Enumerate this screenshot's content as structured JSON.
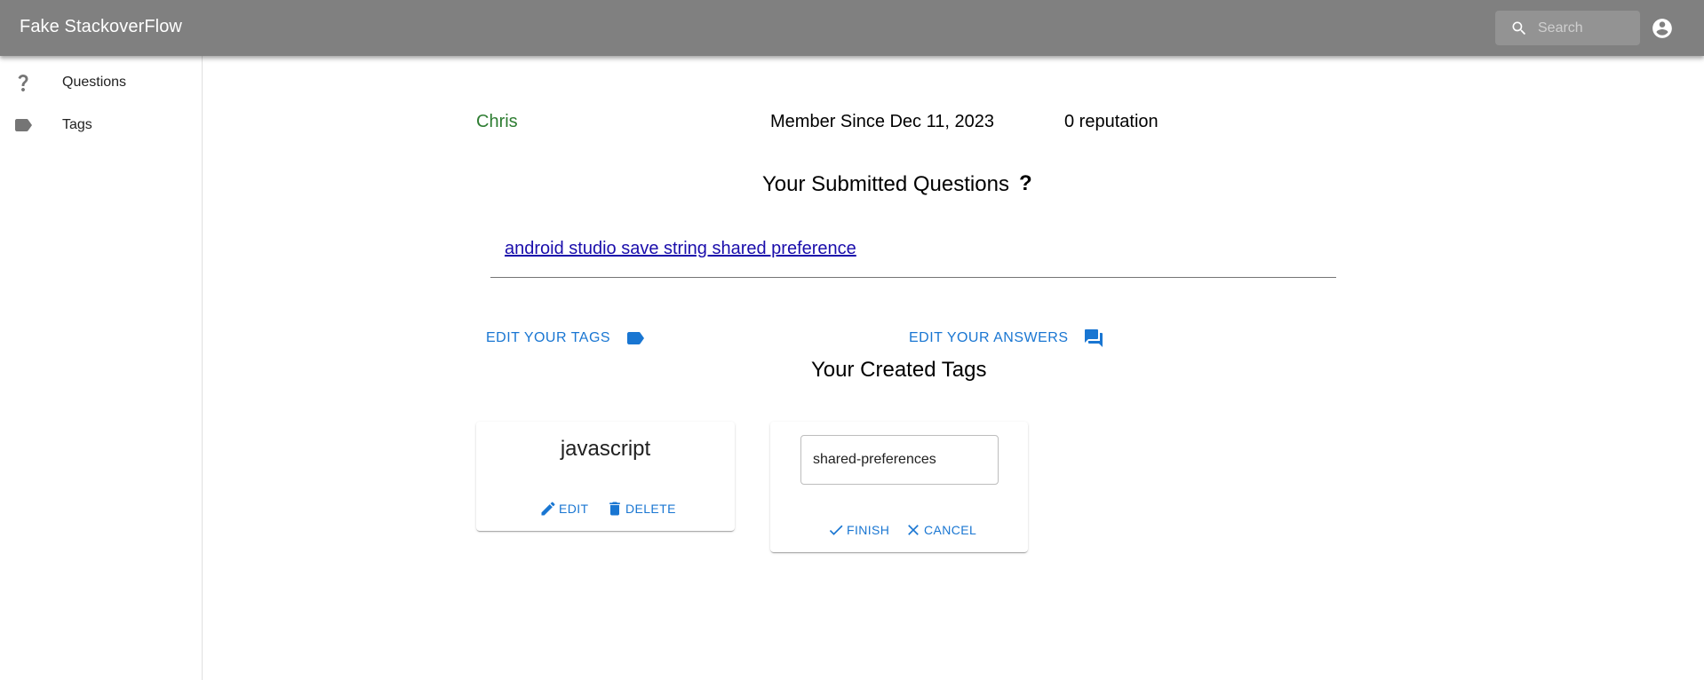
{
  "appbar": {
    "title": "Fake StackoverFlow",
    "search_placeholder": "Search",
    "background": "#808080"
  },
  "sidebar": {
    "items": [
      {
        "label": "Questions",
        "icon": "question-mark-icon"
      },
      {
        "label": "Tags",
        "icon": "tag-icon"
      }
    ]
  },
  "profile": {
    "username": "Chris",
    "member_since": "Member Since Dec 11, 2023",
    "reputation": "0 reputation",
    "username_color": "#2e7d32"
  },
  "submitted": {
    "heading": "Your Submitted Questions",
    "help_mark": "?",
    "questions": [
      {
        "title": "android studio save string shared preference"
      }
    ]
  },
  "actions": {
    "edit_tags": "EDIT YOUR TAGS",
    "edit_answers": "EDIT YOUR ANSWERS",
    "accent": "#1976d2"
  },
  "tags": {
    "heading": "Your Created Tags",
    "cards": [
      {
        "name": "javascript",
        "edit_label": "EDIT",
        "delete_label": "DELETE"
      },
      {
        "editing_value": "shared-preferences",
        "finish_label": "FINISH",
        "cancel_label": "CANCEL"
      }
    ]
  }
}
